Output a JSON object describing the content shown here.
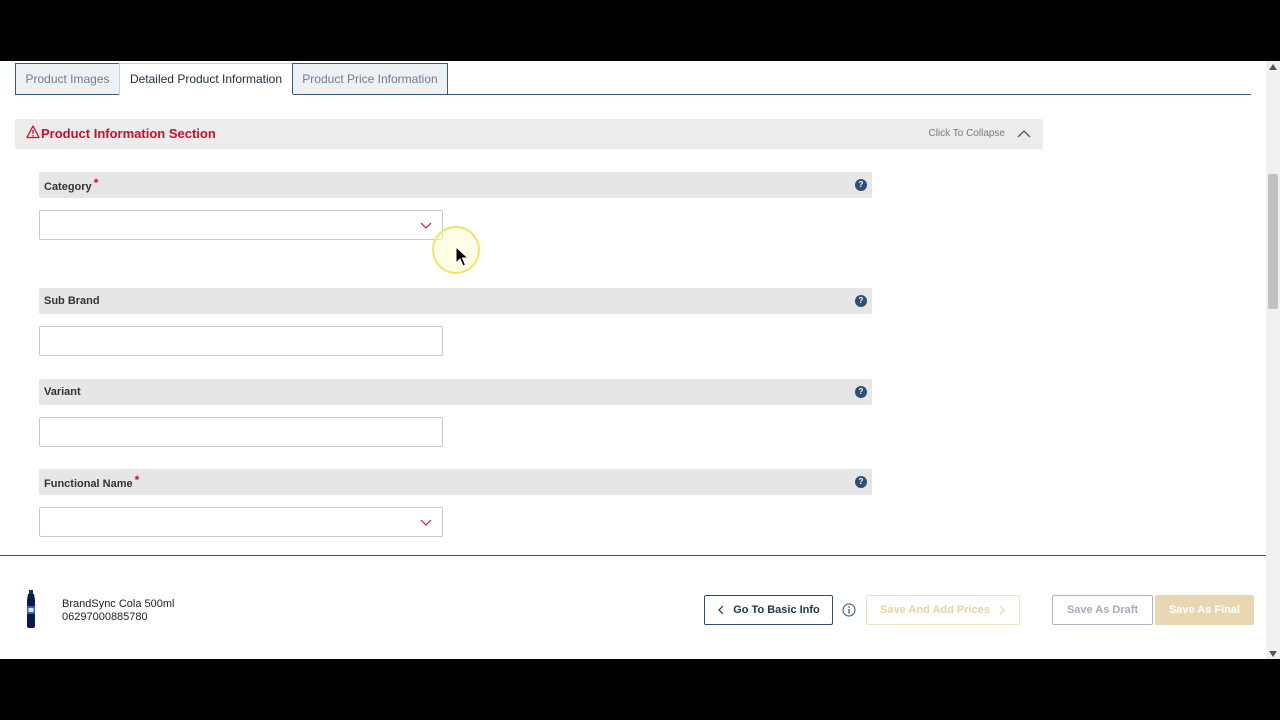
{
  "tabs": [
    {
      "label": "Product Images",
      "active": false
    },
    {
      "label": "Detailed Product Information",
      "active": true
    },
    {
      "label": "Product Price Information",
      "active": false
    }
  ],
  "section": {
    "title": "Product Information Section",
    "collapse_label": "Click To Collapse"
  },
  "fields": [
    {
      "label": "Category",
      "required": true,
      "value": "",
      "type": "select"
    },
    {
      "label": "Sub Brand",
      "required": false,
      "value": "",
      "type": "text"
    },
    {
      "label": "Variant",
      "required": false,
      "value": "",
      "type": "text"
    },
    {
      "label": "Functional Name",
      "required": true,
      "value": "",
      "type": "select"
    }
  ],
  "required_marker": "*",
  "help_glyph": "?",
  "footer": {
    "product_name": "BrandSync Cola 500ml",
    "product_code": "06297000885780",
    "go_basic_label": "Go To Basic Info",
    "save_add_prices_label": "Save And Add Prices",
    "save_draft_label": "Save As Draft",
    "save_final_label": "Save As Final"
  },
  "colors": {
    "accent_navy": "#2e4f73",
    "warning_red": "#c8102e",
    "final_button": "#e8d8b2"
  }
}
